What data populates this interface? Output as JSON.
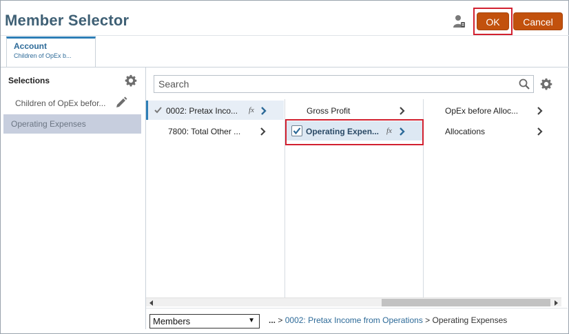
{
  "header": {
    "title": "Member Selector",
    "ok_label": "OK",
    "cancel_label": "Cancel"
  },
  "tab": {
    "title": "Account",
    "subtitle": "Children of OpEx b..."
  },
  "selections": {
    "heading": "Selections",
    "items": [
      {
        "label": "Children of OpEx befor..."
      },
      {
        "label": "Operating Expenses"
      }
    ]
  },
  "search": {
    "placeholder": "Search"
  },
  "columns": [
    {
      "rows": [
        {
          "label": "0002: Pretax Inco...",
          "checked": true,
          "fx": "fx",
          "active": true
        },
        {
          "label": "7800: Total Other ..."
        }
      ]
    },
    {
      "rows": [
        {
          "label": "Gross Profit"
        },
        {
          "label": "Operating Expen...",
          "checked": true,
          "fx": "fx",
          "selected": true
        }
      ]
    },
    {
      "rows": [
        {
          "label": "OpEx before Alloc..."
        },
        {
          "label": "Allocations"
        }
      ]
    }
  ],
  "footer": {
    "members_select": "Members",
    "breadcrumb_prefix": "...",
    "breadcrumb_sep": ">",
    "breadcrumb_link": "0002: Pretax Income from Operations",
    "breadcrumb_current": "Operating Expenses"
  },
  "colors": {
    "title": "#3f6075",
    "button": "#c2510d",
    "accent": "#2d7eb6",
    "highlight": "#d2202f"
  }
}
